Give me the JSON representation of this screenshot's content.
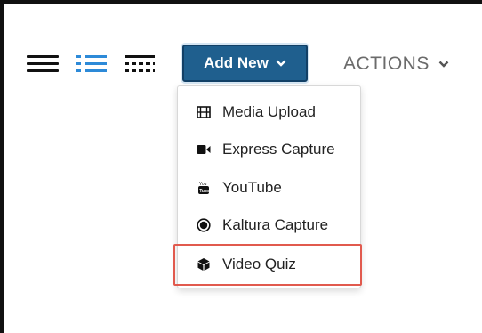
{
  "toolbar": {
    "view_icons": [
      "hamburger-icon",
      "list-view-icon",
      "detailed-view-icon"
    ],
    "add_new_label": "Add New",
    "actions_label": "ACTIONS"
  },
  "dropdown": {
    "items": [
      {
        "label": "Media Upload",
        "icon": "film-icon"
      },
      {
        "label": "Express Capture",
        "icon": "video-camera-icon"
      },
      {
        "label": "YouTube",
        "icon": "youtube-icon"
      },
      {
        "label": "Kaltura Capture",
        "icon": "record-icon"
      },
      {
        "label": "Video Quiz",
        "icon": "cube-icon"
      }
    ],
    "highlighted_item": "Video Quiz"
  },
  "colors": {
    "button_bg": "#1f5f8e",
    "active_view": "#2d8ad8",
    "highlight_border": "#e15a4e",
    "actions_text": "#6b6b6b"
  }
}
